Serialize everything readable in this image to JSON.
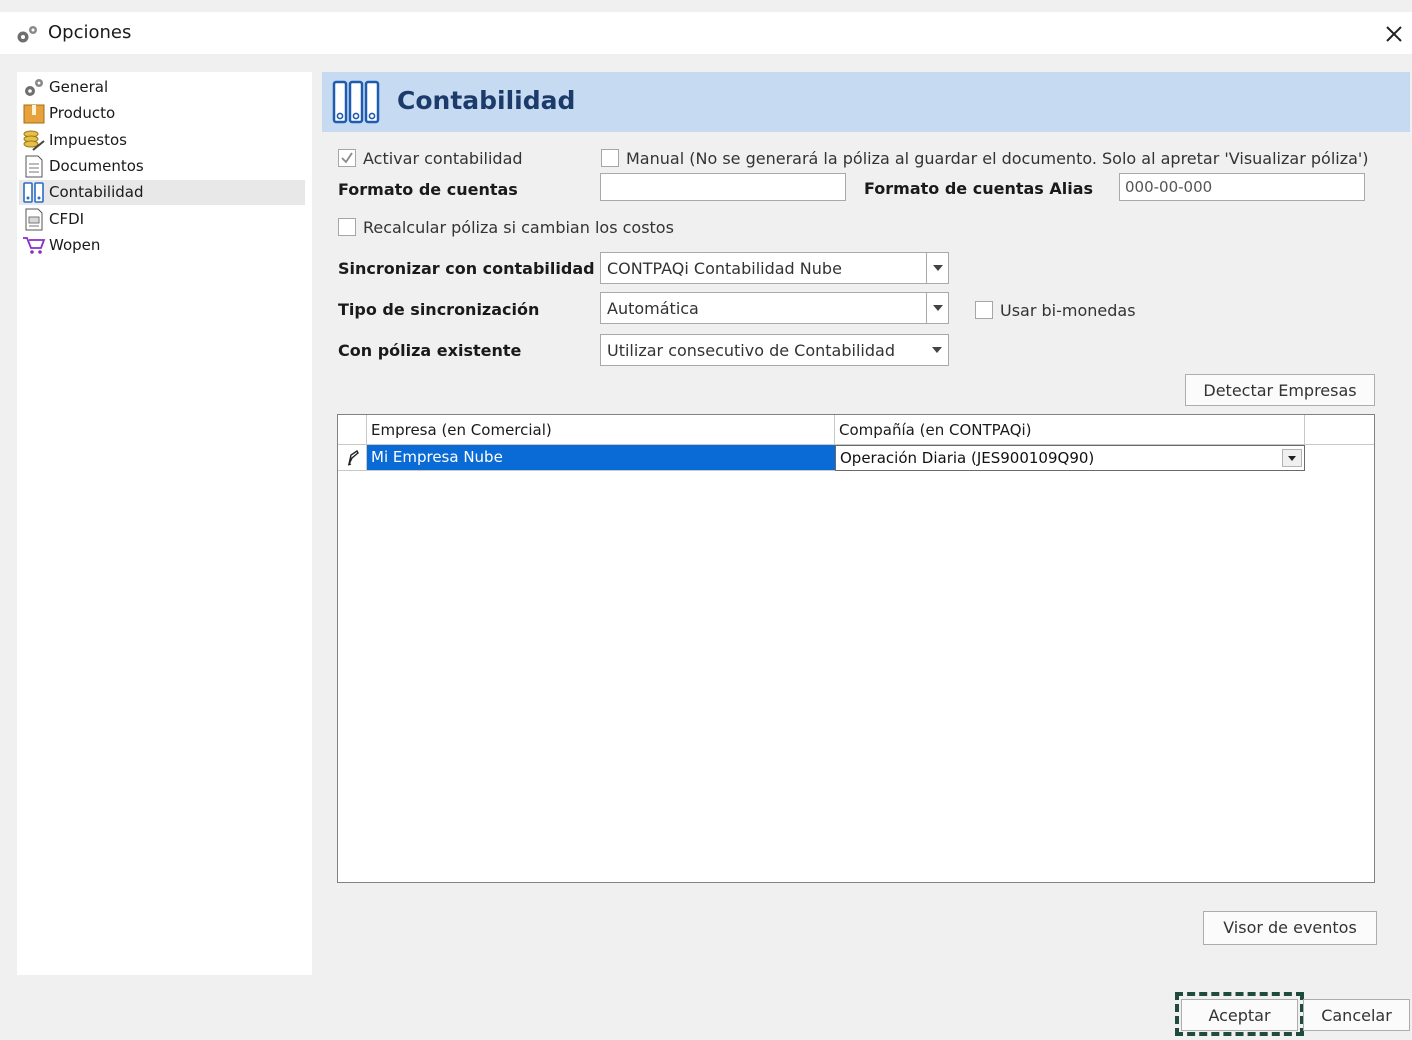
{
  "window": {
    "title": "Opciones"
  },
  "sidebar": {
    "items": [
      {
        "label": "General",
        "icon": "gears-icon"
      },
      {
        "label": "Producto",
        "icon": "box-icon"
      },
      {
        "label": "Impuestos",
        "icon": "coins-icon"
      },
      {
        "label": "Documentos",
        "icon": "document-icon"
      },
      {
        "label": "Contabilidad",
        "icon": "binders-icon",
        "selected": true
      },
      {
        "label": "CFDI",
        "icon": "invoice-icon"
      },
      {
        "label": "Wopen",
        "icon": "cart-icon"
      }
    ]
  },
  "header": {
    "title": "Contabilidad"
  },
  "form": {
    "activar": {
      "label": "Activar contabilidad",
      "checked": true
    },
    "manual": {
      "label": "Manual (No se generará la póliza al guardar el documento. Solo al apretar 'Visualizar póliza')",
      "checked": false
    },
    "formato_cuentas": {
      "label": "Formato de cuentas",
      "value": ""
    },
    "formato_alias": {
      "label": "Formato de cuentas Alias",
      "value": "000-00-000"
    },
    "recalcular": {
      "label": "Recalcular póliza si cambian los costos",
      "checked": false
    },
    "sincronizar": {
      "label": "Sincronizar con contabilidad",
      "value": "CONTPAQi Contabilidad Nube"
    },
    "tipo": {
      "label": "Tipo de sincronización",
      "value": "Automática"
    },
    "bimonedas": {
      "label": "Usar bi-monedas",
      "checked": false
    },
    "poliza": {
      "label": "Con póliza existente",
      "value": "Utilizar consecutivo de Contabilidad"
    },
    "detectar_label": "Detectar Empresas"
  },
  "grid": {
    "columns": [
      "Empresa (en Comercial)",
      "Compañía (en CONTPAQi)"
    ],
    "rows": [
      {
        "empresa": "Mi Empresa Nube",
        "compania": "Operación Diaria (JES900109Q90)"
      }
    ]
  },
  "buttons": {
    "visor_label": "Visor de eventos",
    "aceptar_label": "Aceptar",
    "cancelar_label": "Cancelar"
  },
  "colors": {
    "header_bg": "#c6dbf2",
    "header_text": "#1d3b6a",
    "selection": "#0a6bd6",
    "focus_dash": "#1f4b3a"
  }
}
